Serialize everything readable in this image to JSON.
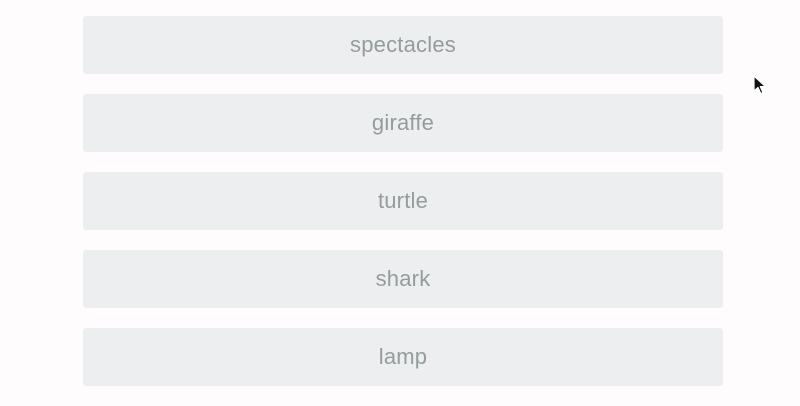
{
  "options": [
    {
      "label": "spectacles"
    },
    {
      "label": "giraffe"
    },
    {
      "label": "turtle"
    },
    {
      "label": "shark"
    },
    {
      "label": "lamp"
    }
  ],
  "colors": {
    "page_background": "#fefcfd",
    "option_background": "#eceeef",
    "option_text": "#949c9c"
  },
  "icons": {
    "cursor": "mouse-pointer-icon"
  }
}
